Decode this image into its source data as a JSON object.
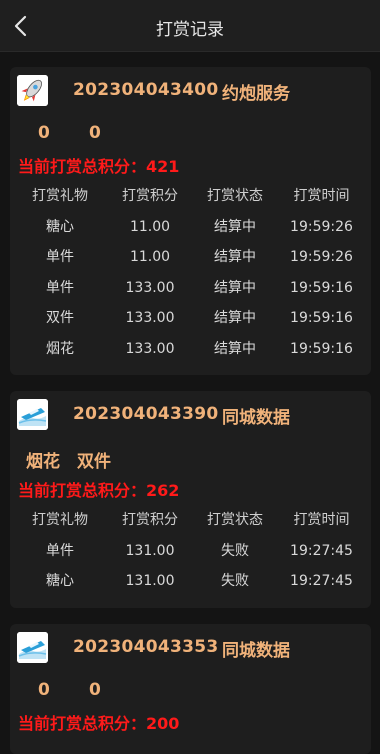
{
  "header": {
    "title": "打赏记录"
  },
  "records": [
    {
      "period": "202304043400",
      "game": "约炮服务",
      "bets": [
        "0",
        "0"
      ],
      "total": "当前打赏总积分：421",
      "columns": [
        "打赏礼物",
        "打赏积分",
        "打赏状态",
        "打赏时间"
      ],
      "rows": [
        [
          "糖心",
          "11.00",
          "结算中",
          "19:59:26"
        ],
        [
          "单件",
          "11.00",
          "结算中",
          "19:59:26"
        ],
        [
          "单件",
          "133.00",
          "结算中",
          "19:59:16"
        ],
        [
          "双件",
          "133.00",
          "结算中",
          "19:59:16"
        ],
        [
          "烟花",
          "133.00",
          "结算中",
          "19:59:16"
        ]
      ]
    },
    {
      "period": "202304043390",
      "game": "同城数据",
      "bets": [
        "烟花",
        "双件"
      ],
      "total": "当前打赏总积分：262",
      "columns": [
        "打赏礼物",
        "打赏积分",
        "打赏状态",
        "打赏时间"
      ],
      "rows": [
        [
          "单件",
          "131.00",
          "失败",
          "19:27:45"
        ],
        [
          "糖心",
          "131.00",
          "失败",
          "19:27:45"
        ]
      ]
    },
    {
      "period": "202304043353",
      "game": "同城数据",
      "bets": [
        "0",
        "0"
      ],
      "total": "当前打赏总积分：200"
    }
  ]
}
